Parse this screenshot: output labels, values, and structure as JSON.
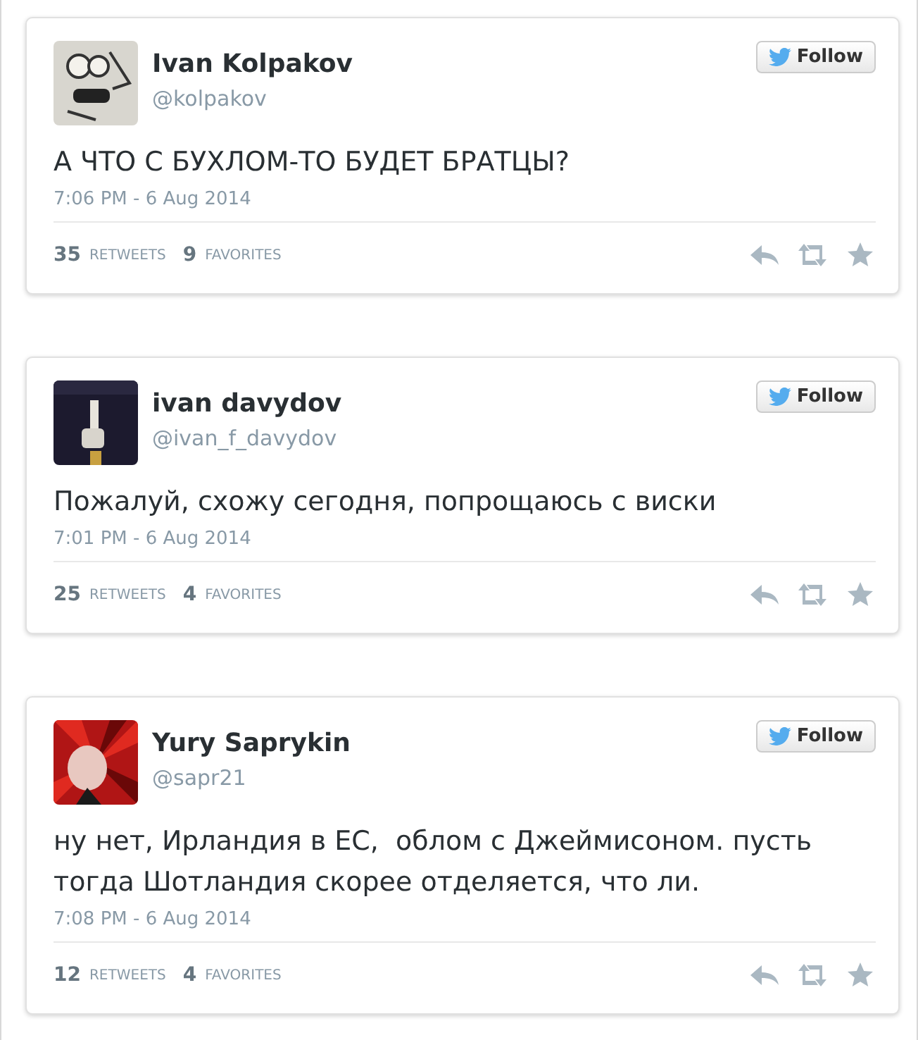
{
  "tweets": [
    {
      "name": "Ivan Kolpakov",
      "handle": "@kolpakov",
      "follow": "Follow",
      "text": "А ЧТО С БУХЛОМ-ТО БУДЕТ БРАТЦЫ?",
      "time": "7:06 PM - 6 Aug 2014",
      "retweets": "35",
      "retweets_label": "RETWEETS",
      "favorites": "9",
      "favorites_label": "FAVORITES"
    },
    {
      "name": "ivan davydov",
      "handle": "@ivan_f_davydov",
      "follow": "Follow",
      "text": "Пожалуй, схожу сегодня, попрощаюсь с виски",
      "time": "7:01 PM - 6 Aug 2014",
      "retweets": "25",
      "retweets_label": "RETWEETS",
      "favorites": "4",
      "favorites_label": "FAVORITES"
    },
    {
      "name": "Yury Saprykin",
      "handle": "@sapr21",
      "follow": "Follow",
      "text": "ну нет, Ирландия в ЕС,  облом с Джеймисоном. пусть тогда Шотландия скорее отделяется, что ли.",
      "time": "7:08 PM - 6 Aug 2014",
      "retweets": "12",
      "retweets_label": "RETWEETS",
      "favorites": "4",
      "favorites_label": "FAVORITES"
    }
  ]
}
